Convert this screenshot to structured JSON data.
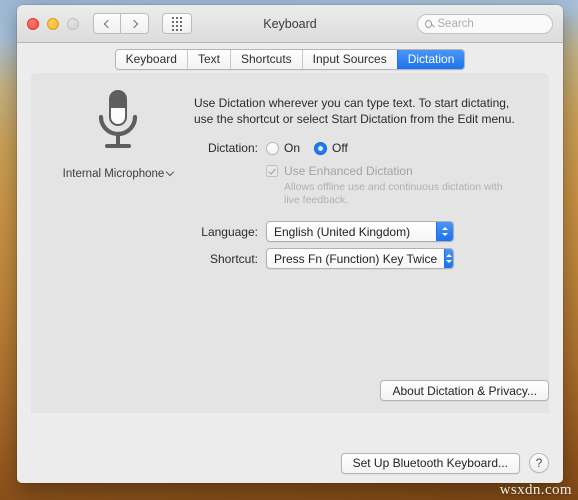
{
  "window": {
    "title": "Keyboard",
    "traffic_lights": [
      "close",
      "minimize",
      "zoom-disabled"
    ],
    "nav": {
      "back": "back-icon",
      "forward": "forward-icon",
      "grid": "show-all-icon"
    },
    "search": {
      "placeholder": "Search",
      "value": "",
      "icon": "search-icon"
    }
  },
  "tabs": [
    {
      "label": "Keyboard",
      "active": false
    },
    {
      "label": "Text",
      "active": false
    },
    {
      "label": "Shortcuts",
      "active": false
    },
    {
      "label": "Input Sources",
      "active": false
    },
    {
      "label": "Dictation",
      "active": true
    }
  ],
  "main": {
    "description_line1": "Use Dictation wherever you can type text. To start dictating,",
    "description_line2": "use the shortcut or select Start Dictation from the Edit menu.",
    "microphone": {
      "icon": "microphone-icon",
      "label": "Internal Microphone",
      "chevron": "chevron-down-icon"
    },
    "dictation": {
      "label": "Dictation:",
      "options": [
        {
          "label": "On",
          "selected": false
        },
        {
          "label": "Off",
          "selected": true
        }
      ],
      "enhanced": {
        "label": "Use Enhanced Dictation",
        "checked": true,
        "enabled": false,
        "hint_line1": "Allows offline use and continuous dictation with",
        "hint_line2": "live feedback."
      }
    },
    "language": {
      "label": "Language:",
      "value": "English (United Kingdom)"
    },
    "shortcut": {
      "label": "Shortcut:",
      "value": "Press Fn (Function) Key Twice"
    },
    "about_button": "About Dictation & Privacy..."
  },
  "footer": {
    "bluetooth_button": "Set Up Bluetooth Keyboard...",
    "help_button": "?"
  },
  "watermark": "wsxdn.com",
  "colors": {
    "accent": "#1d7bf2",
    "window_bg": "#ececec",
    "panel_bg": "#e4e4e4"
  }
}
